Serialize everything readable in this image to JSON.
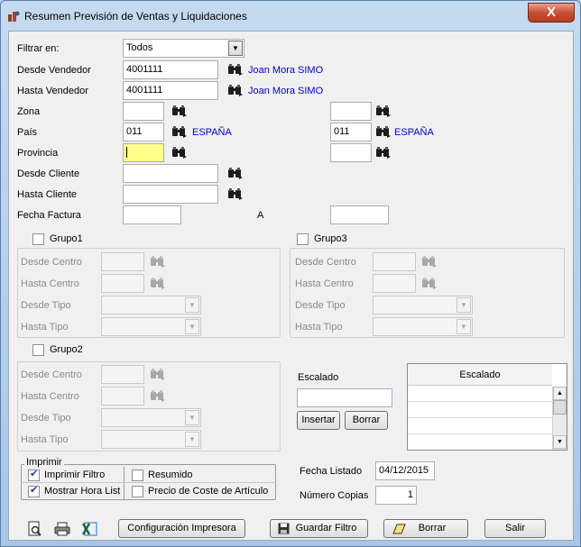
{
  "window": {
    "title": "Resumen Previsión de Ventas y Liquidaciones",
    "close_label": "X"
  },
  "filters": {
    "filtrar_label": "Filtrar en:",
    "filtrar_value": "Todos",
    "desde_vendedor_label": "Desde Vendedor",
    "desde_vendedor_value": "4001111",
    "desde_vendedor_name": "Joan Mora SIMO",
    "hasta_vendedor_label": "Hasta Vendedor",
    "hasta_vendedor_value": "4001111",
    "hasta_vendedor_name": "Joan Mora SIMO",
    "zona_label": "Zona",
    "zona_from": "",
    "zona_to": "",
    "pais_label": "País",
    "pais_from": "011",
    "pais_from_name": "ESPAÑA",
    "pais_to": "011",
    "pais_to_name": "ESPAÑA",
    "provincia_label": "Provincia",
    "provincia_from": "",
    "provincia_to": "",
    "desde_cliente_label": "Desde Cliente",
    "desde_cliente_value": "",
    "hasta_cliente_label": "Hasta Cliente",
    "hasta_cliente_value": "",
    "fecha_factura_label": "Fecha Factura",
    "fecha_factura_from": "",
    "fecha_a_label": "A",
    "fecha_factura_to": ""
  },
  "grupo1": {
    "label": "Grupo1",
    "checked": false,
    "desde_centro": "Desde Centro",
    "hasta_centro": "Hasta Centro",
    "desde_tipo": "Desde Tipo",
    "hasta_tipo": "Hasta Tipo"
  },
  "grupo3": {
    "label": "Grupo3",
    "checked": false,
    "desde_centro": "Desde Centro",
    "hasta_centro": "Hasta Centro",
    "desde_tipo": "Desde Tipo",
    "hasta_tipo": "Hasta Tipo"
  },
  "grupo2": {
    "label": "Grupo2",
    "checked": false,
    "desde_centro": "Desde Centro",
    "hasta_centro": "Hasta Centro",
    "desde_tipo": "Desde Tipo",
    "hasta_tipo": "Hasta Tipo"
  },
  "escalado": {
    "label": "Escalado",
    "input_value": "",
    "insertar_label": "Insertar",
    "borrar_label": "Borrar",
    "grid_header": "Escalado"
  },
  "imprimir": {
    "title": "Imprimir",
    "imprimir_filtro": "Imprimir Filtro",
    "imprimir_filtro_checked": true,
    "mostrar_hora": "Mostrar Hora Lista",
    "mostrar_hora_checked": true,
    "resumido": "Resumido",
    "resumido_checked": false,
    "precio_coste": "Precio de Coste de Artículo",
    "precio_coste_checked": false
  },
  "listado": {
    "fecha_label": "Fecha Listado",
    "fecha_value": "04/12/2015",
    "copias_label": "Número Copias",
    "copias_value": "1"
  },
  "footer": {
    "configuracion_label": "Configuración Impresora",
    "guardar_label": "Guardar Filtro",
    "borrar_label": "Borrar",
    "salir_label": "Salir"
  },
  "colors": {
    "link": "#0000cc",
    "focus_field": "#ffff8c",
    "close_button": "#c75036"
  },
  "icons": [
    "app-icon",
    "binoculars-icon",
    "print-preview-icon",
    "printer-icon",
    "excel-export-icon",
    "save-icon",
    "eraser-icon"
  ]
}
